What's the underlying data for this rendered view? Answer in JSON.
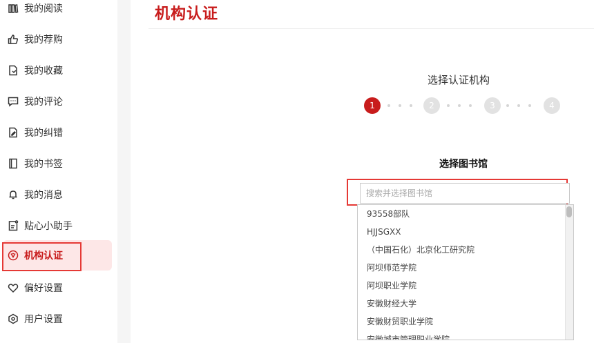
{
  "sidebar": {
    "items": [
      {
        "label": "我的阅读",
        "icon": "book-shelf-icon"
      },
      {
        "label": "我的荐购",
        "icon": "thumbs-up-icon"
      },
      {
        "label": "我的收藏",
        "icon": "bookmark-document-icon"
      },
      {
        "label": "我的评论",
        "icon": "comment-icon"
      },
      {
        "label": "我的纠错",
        "icon": "edit-document-icon"
      },
      {
        "label": "我的书签",
        "icon": "bookmark-icon"
      },
      {
        "label": "我的消息",
        "icon": "bell-icon"
      },
      {
        "label": "贴心小助手",
        "icon": "assistant-icon"
      },
      {
        "label": "机构认证",
        "icon": "institution-icon",
        "active": true
      },
      {
        "label": "偏好设置",
        "icon": "heart-icon"
      },
      {
        "label": "用户设置",
        "icon": "user-settings-icon"
      }
    ]
  },
  "main": {
    "page_title": "机构认证",
    "step_title": "选择认证机构",
    "steps": [
      "1",
      "2",
      "3",
      "4"
    ],
    "current_step": 1,
    "library_label": "选择图书馆",
    "search": {
      "placeholder": "搜索并选择图书馆",
      "value": ""
    },
    "options": [
      "93558部队",
      "HJJSGXX",
      "（中国石化）北京化工研究院",
      "阿坝师范学院",
      "阿坝职业学院",
      "安徽财经大学",
      "安徽财贸职业学院",
      "安徽城市管理职业学院"
    ]
  },
  "colors": {
    "accent": "#c81c1c",
    "highlight_box": "#e53935",
    "active_bg": "#fde7e7"
  }
}
